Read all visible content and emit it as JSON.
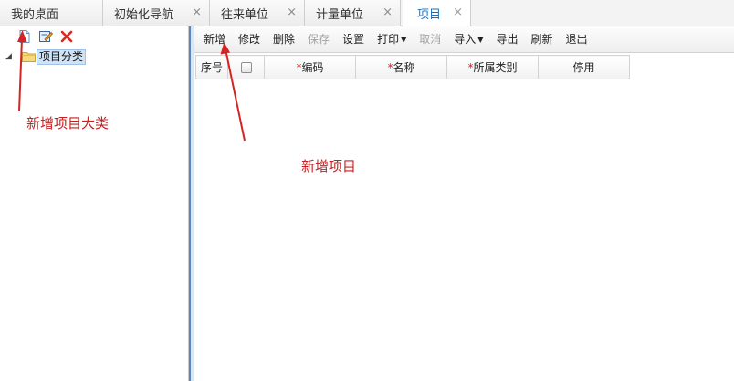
{
  "tabs": [
    {
      "label": "我的桌面",
      "closable": false,
      "active": false
    },
    {
      "label": "初始化导航",
      "closable": true,
      "active": false
    },
    {
      "label": "往来单位",
      "closable": true,
      "active": false
    },
    {
      "label": "计量单位",
      "closable": true,
      "active": false
    },
    {
      "label": "项目",
      "closable": true,
      "active": true
    }
  ],
  "close_glyph": "×",
  "left_toolbar": {
    "icons": [
      "new-document-icon",
      "edit-icon",
      "delete-icon"
    ]
  },
  "tree": {
    "toggle": "◢",
    "root_label": "项目分类"
  },
  "toolbar": {
    "buttons": [
      {
        "label": "新增",
        "enabled": true
      },
      {
        "label": "修改",
        "enabled": true
      },
      {
        "label": "删除",
        "enabled": true
      },
      {
        "label": "保存",
        "enabled": false
      },
      {
        "label": "设置",
        "enabled": true
      },
      {
        "label": "打印",
        "enabled": true,
        "dropdown": true
      },
      {
        "label": "取消",
        "enabled": false
      },
      {
        "label": "导入",
        "enabled": true,
        "dropdown": true
      },
      {
        "label": "导出",
        "enabled": true
      },
      {
        "label": "刷新",
        "enabled": true
      },
      {
        "label": "退出",
        "enabled": true
      }
    ],
    "caret": "▼"
  },
  "grid": {
    "headers": [
      {
        "label": "序号",
        "required": false
      },
      {
        "label": "",
        "checkbox": true
      },
      {
        "label": "编码",
        "required": true
      },
      {
        "label": "名称",
        "required": true
      },
      {
        "label": "所属类别",
        "required": true
      },
      {
        "label": "停用",
        "required": false
      }
    ],
    "required_mark": "*"
  },
  "annotations": {
    "left": "新增项目大类",
    "right": "新增项目",
    "color": "#c62020"
  }
}
